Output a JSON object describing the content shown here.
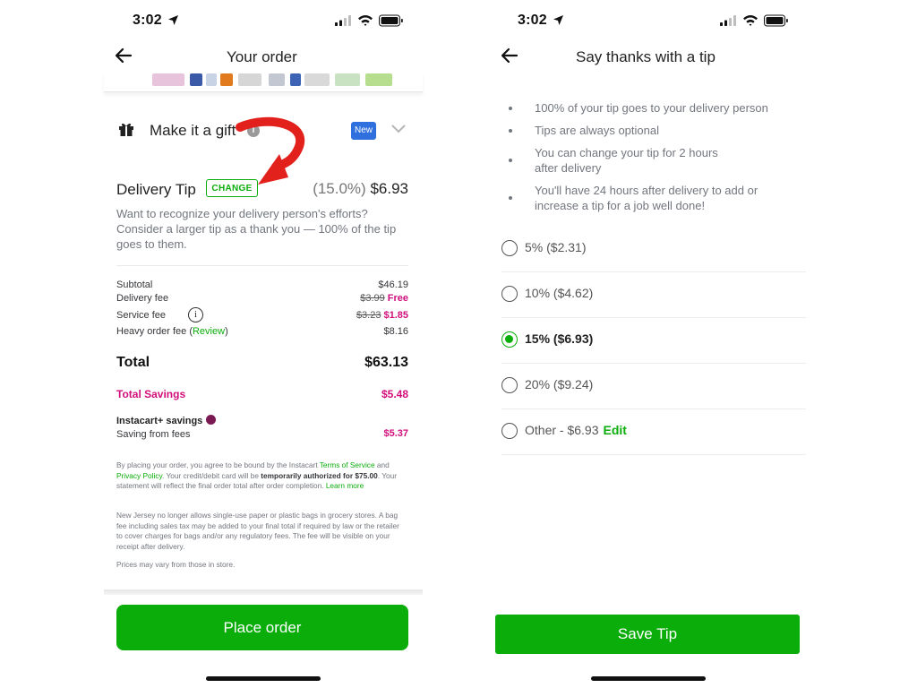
{
  "left": {
    "status_time": "3:02",
    "nav_title": "Your order",
    "gift_label": "Make it a gift",
    "gift_badge": "New",
    "tip_title": "Delivery Tip",
    "change_label": "CHANGE",
    "tip_percent": "(15.0%)",
    "tip_amount": "$6.93",
    "tip_description": "Want to recognize your delivery person's efforts? Consider a larger tip as a thank you — 100% of the tip goes to them.",
    "fees": {
      "subtotal_label": "Subtotal",
      "subtotal_value": "$46.19",
      "delivery_label": "Delivery fee",
      "delivery_old": "$3.99",
      "delivery_new": "Free",
      "service_label": "Service fee",
      "service_old": "$3.23",
      "service_new": "$1.85",
      "heavy_label": "Heavy order fee (",
      "heavy_link": "Review",
      "heavy_close": ")",
      "heavy_value": "$8.16"
    },
    "total_label": "Total",
    "total_value": "$63.13",
    "savings_label": "Total Savings",
    "savings_value": "$5.48",
    "instacart_plus_label": "Instacart+ savings",
    "saving_fees_label": "Saving from fees",
    "saving_fees_value": "$5.37",
    "legal": {
      "p1_a": "By placing your order, you agree to be bound by the Instacart ",
      "p1_terms": "Terms of Service",
      "p1_b": " and ",
      "p1_privacy": "Privacy Policy",
      "p1_c": ". Your credit/debit card will be ",
      "p1_bold": "temporarily authorized for $75.00",
      "p1_d": ". Your statement will reflect the final order total after order completion. ",
      "p1_learn": "Learn more",
      "p2": "New Jersey no longer allows single-use paper or plastic bags in grocery stores. A bag fee including sales tax may be added to your final total if required by law or the retailer to cover charges for bags and/or any regulatory fees. The fee will be visible on your receipt after delivery.",
      "p3": "Prices may vary from those in store."
    },
    "place_order_label": "Place order"
  },
  "right": {
    "status_time": "3:02",
    "nav_title": "Say thanks with a tip",
    "bullets": [
      "100% of your tip goes to your delivery person",
      "Tips are always optional",
      "You can change your tip for 2 hours after delivery",
      "You'll have 24 hours after delivery to add or increase a tip for a job well done!"
    ],
    "options": [
      {
        "label": "5% ($2.31)",
        "selected": false
      },
      {
        "label": "10% ($4.62)",
        "selected": false
      },
      {
        "label": "15% ($6.93)",
        "selected": true
      },
      {
        "label": "20% ($9.24)",
        "selected": false
      },
      {
        "label": "Other - $6.93",
        "selected": false,
        "edit": "Edit"
      }
    ],
    "save_label": "Save Tip"
  },
  "colors": {
    "accent_green": "#0aad0a",
    "promo_pink": "#d10e7c",
    "annotation_red": "#e3211c",
    "new_badge_blue": "#2f6fde"
  },
  "icons": [
    "location-arrow-icon",
    "signal-icon",
    "wifi-icon",
    "battery-icon",
    "back-arrow-icon",
    "gift-icon",
    "info-icon",
    "chevron-down-icon",
    "red-annotation-arrow",
    "plus-membership-icon"
  ]
}
